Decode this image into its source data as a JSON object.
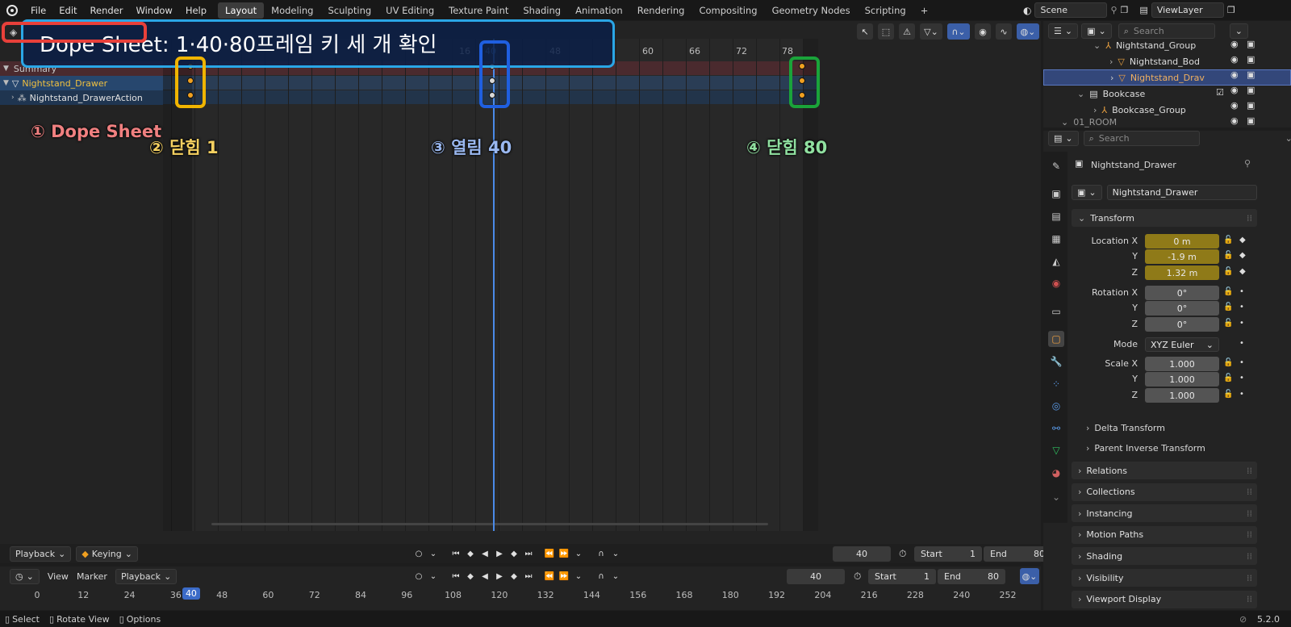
{
  "topbar": {
    "menus": [
      "File",
      "Edit",
      "Render",
      "Window",
      "Help"
    ],
    "workspaces": [
      "Layout",
      "Modeling",
      "Sculpting",
      "UV Editing",
      "Texture Paint",
      "Shading",
      "Animation",
      "Rendering",
      "Compositing",
      "Geometry Nodes",
      "Scripting"
    ],
    "active_workspace": "Layout",
    "add_tab": "+",
    "scene": "Scene",
    "view_layer": "ViewLayer"
  },
  "overlay": {
    "title": "Dope Sheet: 1·40·80프레임 키 세 개 확인",
    "label1": "① Dope Sheet",
    "label2": "② 닫힘 1",
    "label3": "③ 열림 40",
    "label4": "④ 닫힘 80",
    "colors": {
      "red": "#e8403a",
      "blue": "#2aa6e6",
      "yellow": "#f0b400",
      "navy": "#1f5fe0",
      "green": "#1aa33a"
    }
  },
  "dopesheet": {
    "ruler_ticks": [
      "16",
      "40",
      "48",
      "60",
      "66",
      "72",
      "78"
    ],
    "channels": {
      "summary": "Summary",
      "object": "Nightstand_Drawer",
      "action": "Nightstand_DrawerAction"
    },
    "keyframes": [
      1,
      40,
      80
    ],
    "playback": "Playback",
    "keying": "Keying",
    "current_frame": "40",
    "start_label": "Start",
    "start": "1",
    "end_label": "End",
    "end": "80"
  },
  "timeline": {
    "view": "View",
    "marker": "Marker",
    "playback": "Playback",
    "current_frame": "40",
    "start_label": "Start",
    "start": "1",
    "end_label": "End",
    "end": "80",
    "ticks": [
      "0",
      "12",
      "24",
      "36",
      "40",
      "48",
      "60",
      "72",
      "84",
      "96",
      "108",
      "120",
      "132",
      "144",
      "156",
      "168",
      "180",
      "192",
      "204",
      "216",
      "228",
      "240",
      "252"
    ]
  },
  "status": {
    "select": "Select",
    "rotate": "Rotate View",
    "options": "Options",
    "version": "5.2.0"
  },
  "outliner": {
    "search_placeholder": "Search",
    "rows": [
      "Nightstand_Group",
      "Nightstand_Bod",
      "Nightstand_Drav",
      "Bookcase",
      "Bookcase_Group",
      "01_ROOM"
    ]
  },
  "properties": {
    "search_placeholder": "Search",
    "object_name": "Nightstand_Drawer",
    "object_field": "Nightstand_Drawer",
    "transform": "Transform",
    "location_label": "Location X",
    "y_label": "Y",
    "z_label": "Z",
    "location": [
      "0 m",
      "-1.9 m",
      "1.32 m"
    ],
    "rotation_label": "Rotation X",
    "rotation": [
      "0°",
      "0°",
      "0°"
    ],
    "mode_label": "Mode",
    "mode": "XYZ Euler",
    "scale_label": "Scale X",
    "scale": [
      "1.000",
      "1.000",
      "1.000"
    ],
    "delta": "Delta Transform",
    "parent_inverse": "Parent Inverse Transform",
    "panels": [
      "Relations",
      "Collections",
      "Instancing",
      "Motion Paths",
      "Shading",
      "Visibility",
      "Viewport Display"
    ]
  }
}
